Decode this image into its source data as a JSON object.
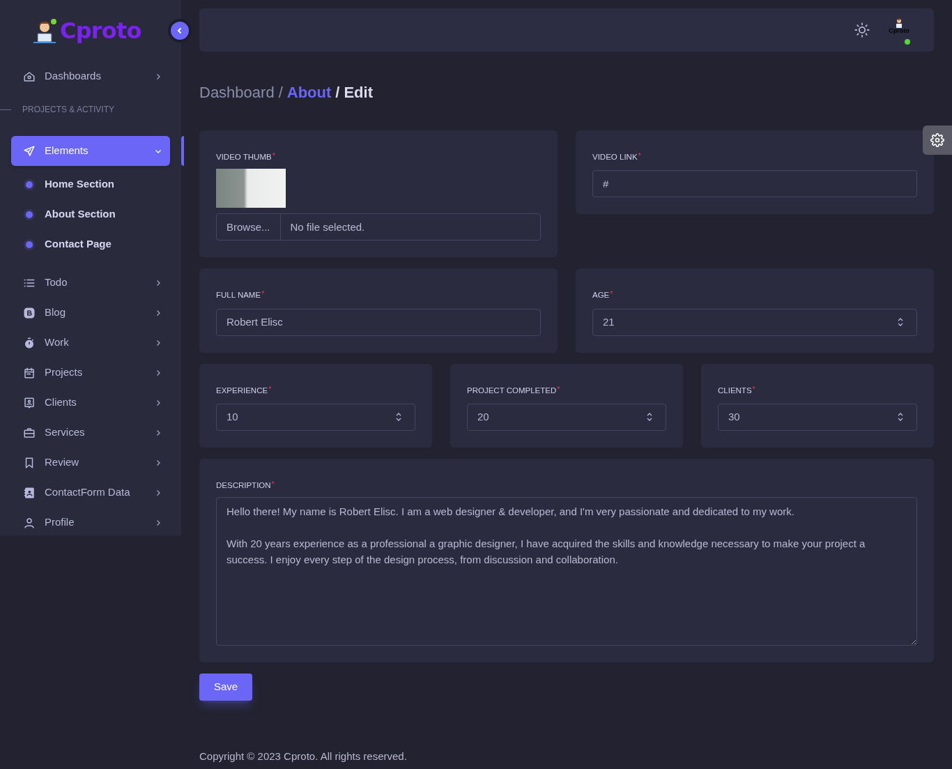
{
  "sidebar": {
    "brand": "Cproto",
    "items": [
      {
        "kind": "link",
        "label": "Dashboards",
        "selected": false
      },
      {
        "kind": "heading",
        "label": "PROJECTS & ACTIVITY"
      },
      {
        "kind": "group",
        "label": "Elements",
        "selected": true,
        "expanded": true,
        "children": [
          {
            "label": "Home Section"
          },
          {
            "label": "About Section"
          },
          {
            "label": "Contact Page"
          }
        ]
      },
      {
        "kind": "link",
        "label": "Todo",
        "selected": false
      },
      {
        "kind": "link",
        "label": "Blog",
        "selected": false
      },
      {
        "kind": "link",
        "label": "Work",
        "selected": false
      },
      {
        "kind": "link",
        "label": "Projects",
        "selected": false
      },
      {
        "kind": "link",
        "label": "Clients",
        "selected": false
      },
      {
        "kind": "link",
        "label": "Services",
        "selected": false
      },
      {
        "kind": "link",
        "label": "Review",
        "selected": false
      },
      {
        "kind": "link",
        "label": "ContactForm Data",
        "selected": false
      },
      {
        "kind": "link",
        "label": "Profile",
        "selected": false
      }
    ]
  },
  "header": {
    "avatar_text": "Cproto",
    "online": true
  },
  "breadcrumb": {
    "separator": "/",
    "items": [
      {
        "label": "Dashboard",
        "kind": "muted"
      },
      {
        "label": "About",
        "kind": "accent"
      },
      {
        "label": "Edit",
        "kind": "current"
      }
    ]
  },
  "form": {
    "rows": [
      [
        {
          "kind": "file",
          "label": "VIDEO THUMB",
          "required_mark": "*",
          "button": "Browse...",
          "value": "No file selected."
        },
        {
          "kind": "text",
          "label": "VIDEO LINK",
          "required_mark": "*",
          "value": "#"
        }
      ],
      [
        {
          "kind": "text",
          "label": "FULL NAME",
          "required_mark": "*",
          "value": "Robert Elisc"
        },
        {
          "kind": "number",
          "label": "AGE",
          "required_mark": "*",
          "value": "21"
        }
      ],
      [
        {
          "kind": "number",
          "label": "EXPERIENCE",
          "required_mark": "*",
          "value": "10"
        },
        {
          "kind": "number",
          "label": "PROJECT COMPLETED",
          "required_mark": "*",
          "value": "20"
        },
        {
          "kind": "number",
          "label": "CLIENTS",
          "required_mark": "*",
          "value": "30"
        }
      ],
      [
        {
          "kind": "textarea",
          "label": "DESCRIPTION",
          "required_mark": "*",
          "value": "Hello there! My name is Robert Elisc. I am a web designer & developer, and I'm very passionate and dedicated to my work.\n\nWith 20 years experience as a professional a graphic designer, I have acquired the skills and knowledge necessary to make your project a success. I enjoy every step of the design process, from discussion and collaboration."
        }
      ]
    ],
    "submit": "Save"
  },
  "footer": "Copyright © 2023 Cproto. All rights reserved."
}
